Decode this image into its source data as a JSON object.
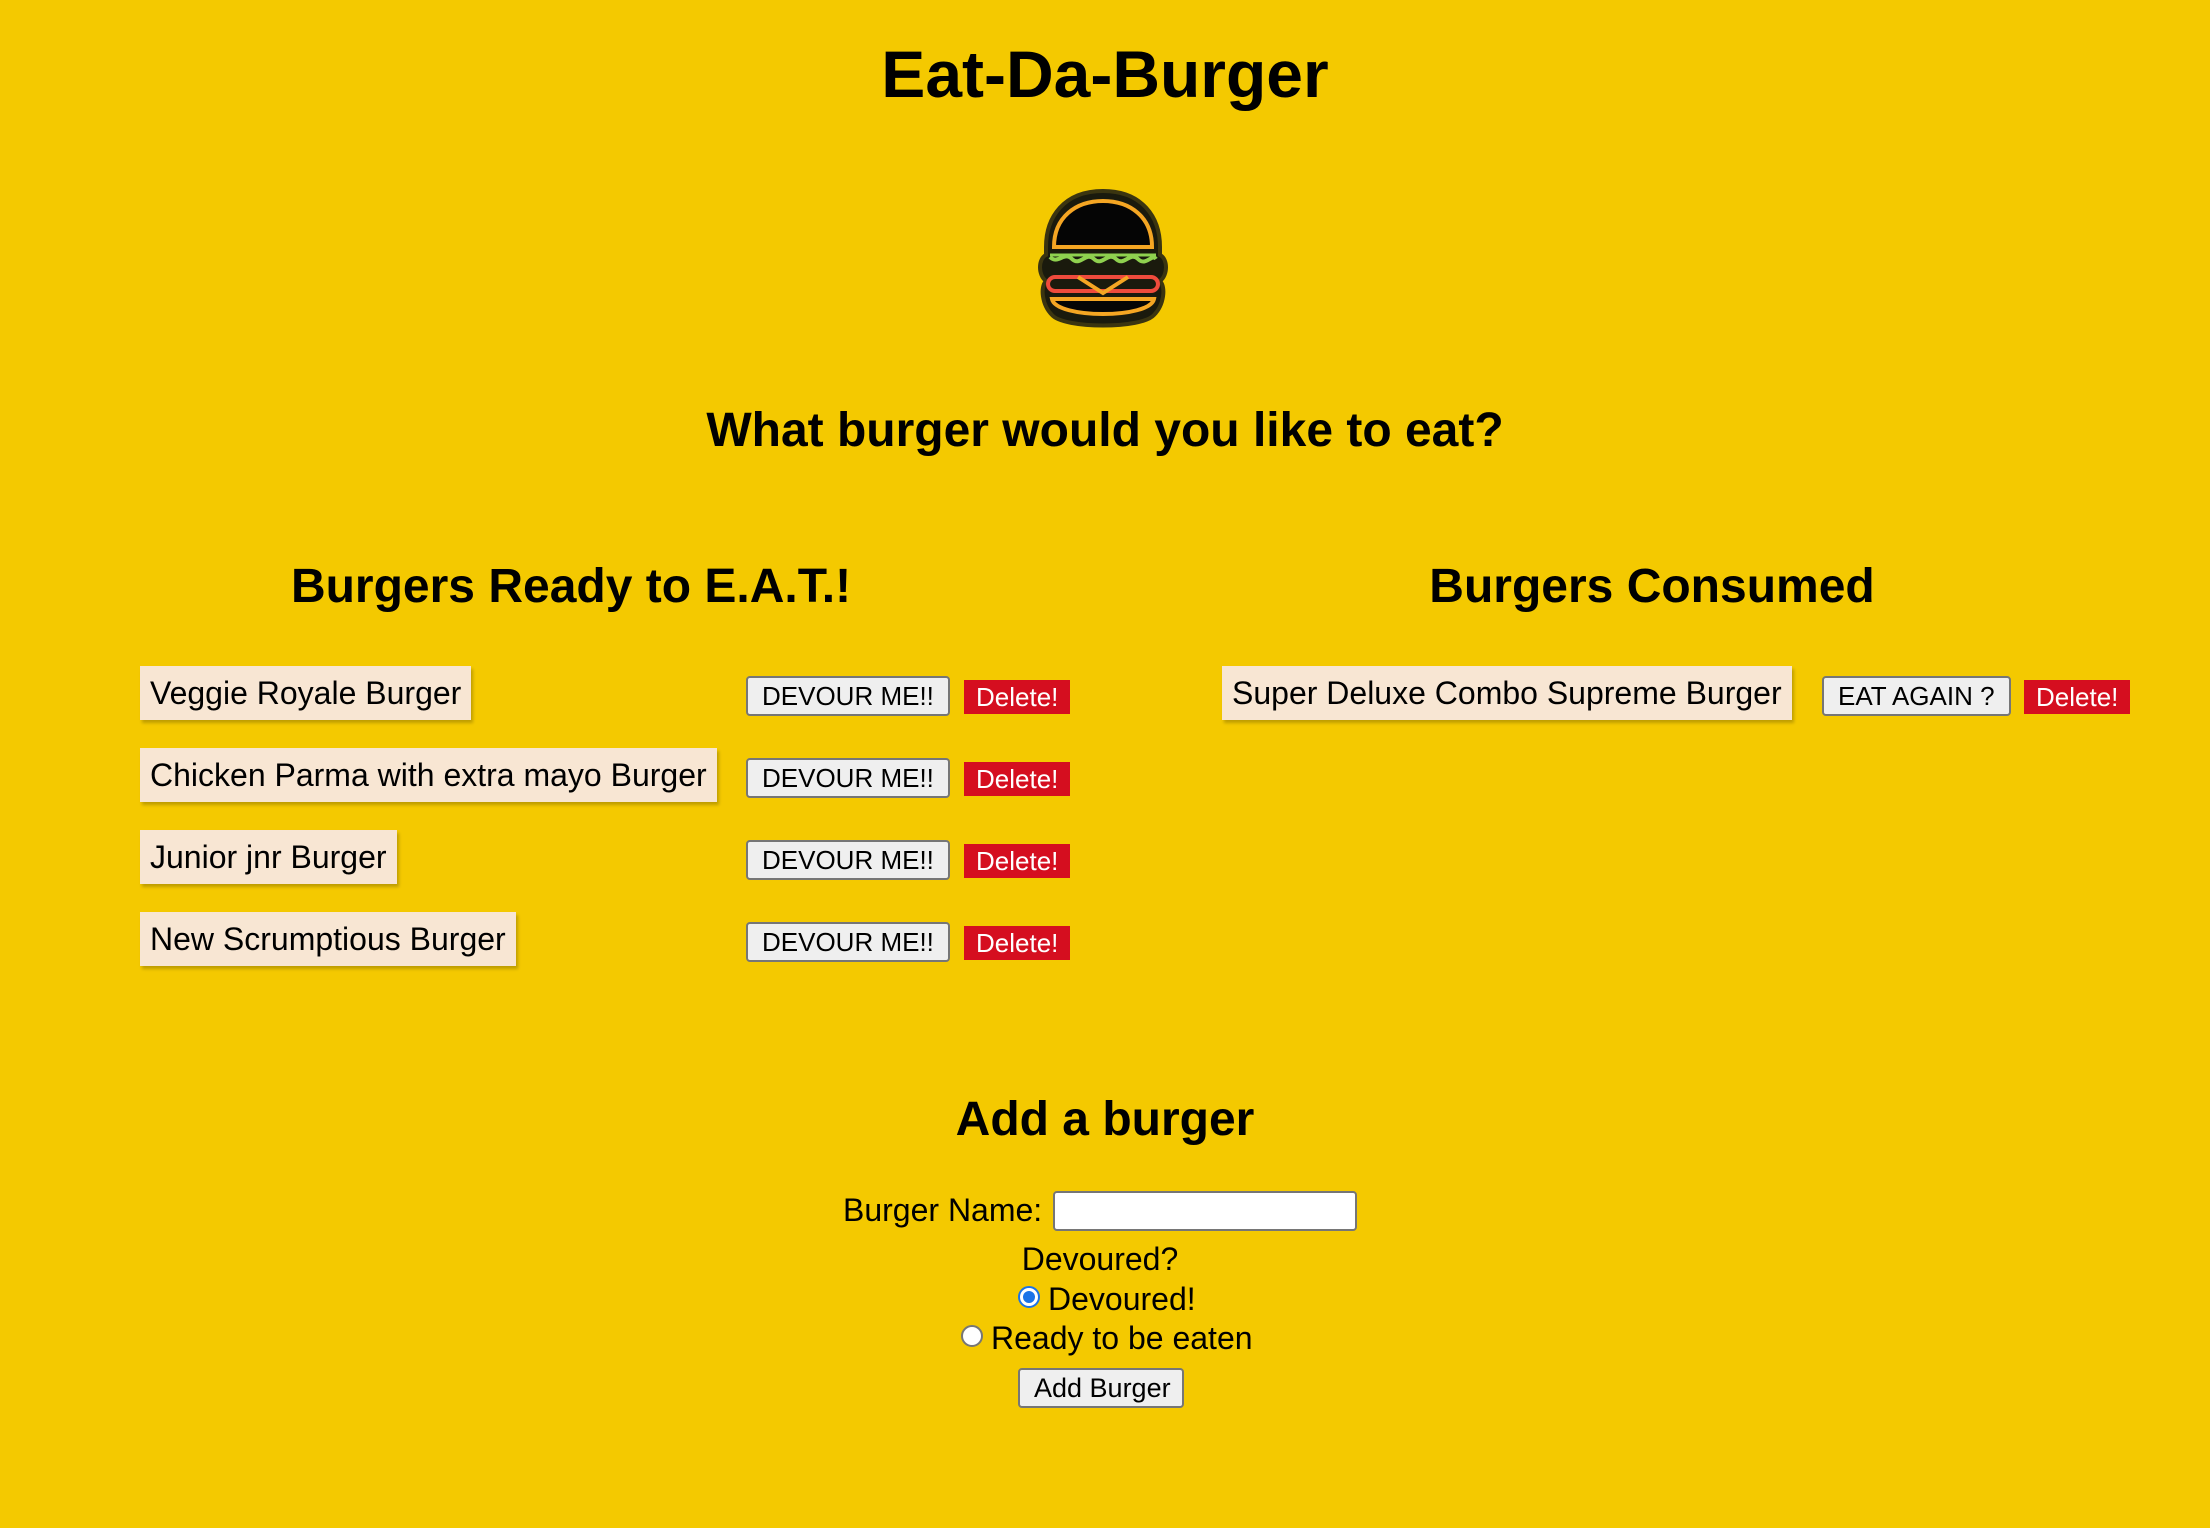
{
  "header": {
    "title": "Eat-Da-Burger",
    "question": "What burger would you like to eat?",
    "logo_icon": "neon-burger-icon"
  },
  "ready": {
    "heading": "Burgers Ready to E.A.T.!",
    "devour_label": "DEVOUR ME!!",
    "delete_label": "Delete!",
    "items": [
      {
        "name": "Veggie Royale Burger"
      },
      {
        "name": "Chicken Parma with extra mayo Burger"
      },
      {
        "name": "Junior jnr Burger"
      },
      {
        "name": "New Scrumptious Burger"
      }
    ]
  },
  "consumed": {
    "heading": "Burgers Consumed",
    "eat_again_label": "EAT AGAIN ?",
    "delete_label": "Delete!",
    "items": [
      {
        "name": "Super Deluxe Combo Supreme Burger"
      }
    ]
  },
  "form": {
    "heading": "Add a burger",
    "name_label": "Burger Name:",
    "name_value": "",
    "devoured_question": "Devoured?",
    "option_devoured": "Devoured!",
    "option_ready": "Ready to be eaten",
    "selected_option": "Devoured!",
    "submit_label": "Add Burger"
  },
  "colors": {
    "background": "#f4c900",
    "delete": "#d50e1f",
    "item_bg": "#f8e6d3"
  }
}
